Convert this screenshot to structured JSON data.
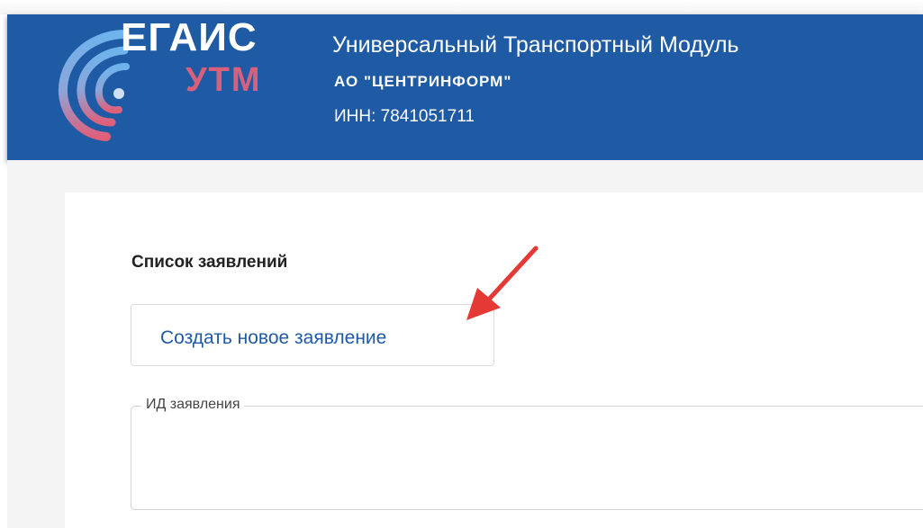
{
  "header": {
    "logo": {
      "top_text": "ЕГАИС",
      "bottom_text": "УТМ",
      "icon": "egais-swirl-logo-icon"
    },
    "app_title": "Универсальный Транспортный Модуль",
    "org_name": "АО \"ЦЕНТРИНФОРМ\"",
    "inn": "ИНН: 7841051711"
  },
  "main": {
    "section_title": "Список заявлений",
    "create_button_label": "Создать новое заявление",
    "id_field": {
      "label": "ИД заявления",
      "value": ""
    }
  },
  "annotation": {
    "icon": "red-pointer-arrow-icon",
    "color": "#e53935"
  },
  "colors": {
    "header_bg": "#1f5aa5",
    "link_blue": "#1f5aa5",
    "logo_pink": "#d9607a"
  }
}
